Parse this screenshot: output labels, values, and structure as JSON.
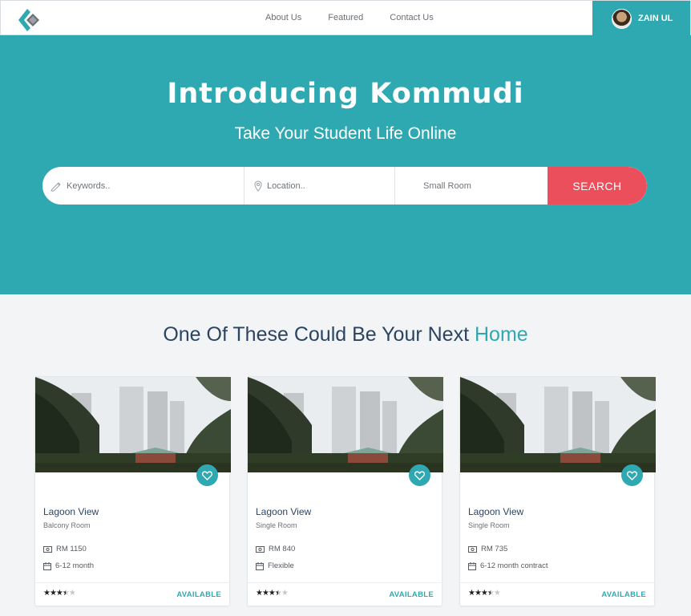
{
  "nav": {
    "links": [
      "About Us",
      "Featured",
      "Contact Us"
    ],
    "user_name": "ZAIN UL"
  },
  "hero": {
    "title": "Introducing Kommudi",
    "subtitle": "Take Your Student Life Online",
    "search": {
      "keywords_placeholder": "Keywords..",
      "location_placeholder": "Location..",
      "room_type": "Small Room",
      "button_label": "SEARCH"
    }
  },
  "section": {
    "title_prefix": "One Of These Could Be Your Next ",
    "title_accent": "Home"
  },
  "listings": [
    {
      "title": "Lagoon View",
      "room": "Balcony Room",
      "price": "RM 1150",
      "term": "6-12 month",
      "rating": 3.5,
      "status": "AVAILABLE"
    },
    {
      "title": "Lagoon View",
      "room": "Single Room",
      "price": "RM 840",
      "term": "Flexible",
      "rating": 3.5,
      "status": "AVAILABLE"
    },
    {
      "title": "Lagoon View",
      "room": "Single Room",
      "price": "RM 735",
      "term": "6-12 month contract",
      "rating": 3.5,
      "status": "AVAILABLE"
    }
  ],
  "colors": {
    "brand_teal": "#2fa9b1",
    "search_red": "#ea4f5b",
    "heading_navy": "#2b4462"
  }
}
